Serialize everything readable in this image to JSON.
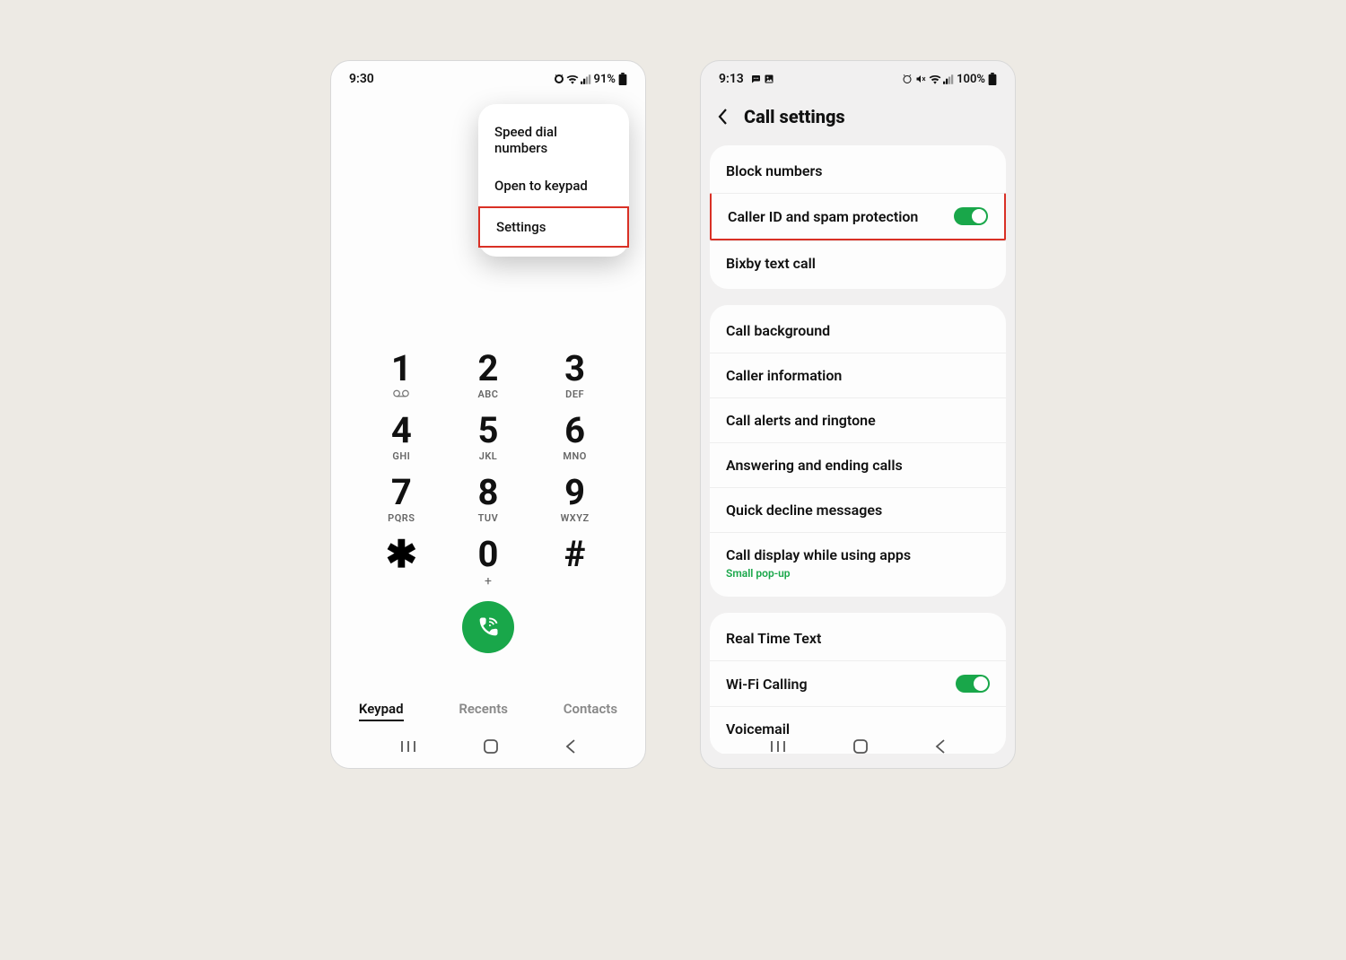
{
  "phone1": {
    "status": {
      "time": "9:30",
      "battery": "91%"
    },
    "menu": {
      "items": [
        "Speed dial numbers",
        "Open to keypad",
        "Settings"
      ]
    },
    "keypad": {
      "keys": [
        {
          "d": "1",
          "s": ""
        },
        {
          "d": "2",
          "s": "ABC"
        },
        {
          "d": "3",
          "s": "DEF"
        },
        {
          "d": "4",
          "s": "GHI"
        },
        {
          "d": "5",
          "s": "JKL"
        },
        {
          "d": "6",
          "s": "MNO"
        },
        {
          "d": "7",
          "s": "PQRS"
        },
        {
          "d": "8",
          "s": "TUV"
        },
        {
          "d": "9",
          "s": "WXYZ"
        },
        {
          "d": "✱",
          "s": ""
        },
        {
          "d": "0",
          "s": "+"
        },
        {
          "d": "#",
          "s": ""
        }
      ]
    },
    "tabs": {
      "keypad": "Keypad",
      "recents": "Recents",
      "contacts": "Contacts"
    }
  },
  "phone2": {
    "status": {
      "time": "9:13",
      "battery": "100%"
    },
    "header": {
      "title": "Call settings"
    },
    "group1": {
      "block_numbers": "Block numbers",
      "caller_id": "Caller ID and spam protection",
      "bixby": "Bixby text call"
    },
    "group2": {
      "call_background": "Call background",
      "caller_info": "Caller information",
      "alerts": "Call alerts and ringtone",
      "answering": "Answering and ending calls",
      "quick_decline": "Quick decline messages",
      "display_apps": "Call display while using apps",
      "display_apps_sub": "Small pop-up"
    },
    "group3": {
      "rtt": "Real Time Text",
      "wifi": "Wi-Fi Calling",
      "voicemail": "Voicemail"
    }
  }
}
